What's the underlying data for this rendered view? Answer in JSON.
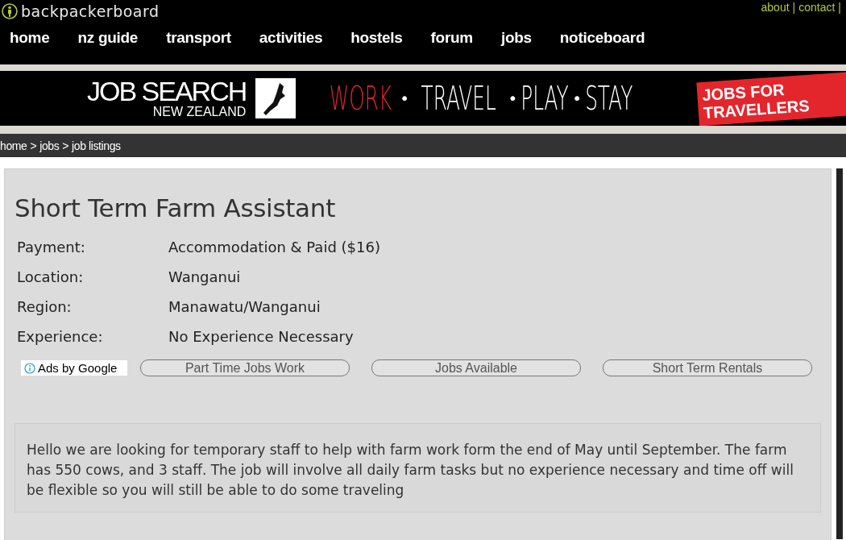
{
  "site": {
    "name": "backpackerboard",
    "top_links": [
      "about",
      "contact"
    ],
    "separator": "|"
  },
  "nav": [
    {
      "label": "home"
    },
    {
      "label": "nz guide"
    },
    {
      "label": "transport"
    },
    {
      "label": "activities"
    },
    {
      "label": "hostels"
    },
    {
      "label": "forum"
    },
    {
      "label": "jobs"
    },
    {
      "label": "noticeboard"
    }
  ],
  "banner": {
    "brand": "JOB SEARCH",
    "brand_sub": "NEW ZEALAND",
    "words": [
      {
        "text": "WORK",
        "highlight": true
      },
      {
        "text": "TRAVEL",
        "highlight": false
      },
      {
        "text": "PLAY",
        "highlight": false
      },
      {
        "text": "STAY",
        "highlight": false
      }
    ],
    "separator": "•",
    "tag": "JOBS FOR TRAVELLERS"
  },
  "breadcrumb": [
    "home",
    "jobs",
    "job listings"
  ],
  "breadcrumb_separator": ">",
  "job": {
    "title": "Short Term Farm Assistant",
    "fields": [
      {
        "label": "Payment:",
        "value": "Accommodation & Paid ($16)"
      },
      {
        "label": "Location:",
        "value": "Wanganui"
      },
      {
        "label": "Region:",
        "value": "Manawatu/Wanganui"
      },
      {
        "label": "Experience:",
        "value": "No Experience Necessary"
      }
    ],
    "ads_label": "Ads by Google",
    "ad_links": [
      "Part Time Jobs Work",
      "Jobs Available",
      "Short Term Rentals"
    ],
    "description": "Hello we are looking for temporary staff to help with farm work form the end of May until September. The farm has 550 cows, and 3 staff. The job will involve all daily farm tasks but no experience necessary and time off will be flexible so you will still be able to do some traveling"
  }
}
